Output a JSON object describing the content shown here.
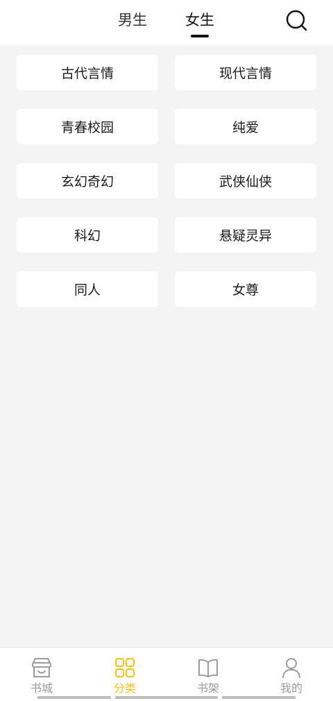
{
  "header": {
    "tabs": [
      {
        "label": "男生",
        "active": false
      },
      {
        "label": "女生",
        "active": true
      }
    ],
    "search_icon": "search-icon"
  },
  "categories": [
    "古代言情",
    "现代言情",
    "青春校园",
    "纯爱",
    "玄幻奇幻",
    "武侠仙侠",
    "科幻",
    "悬疑灵异",
    "同人",
    "女尊"
  ],
  "bottom_nav": {
    "items": [
      {
        "label": "书城",
        "icon": "store-icon",
        "active": false
      },
      {
        "label": "分类",
        "icon": "grid-icon",
        "active": true
      },
      {
        "label": "书架",
        "icon": "book-icon",
        "active": false
      },
      {
        "label": "我的",
        "icon": "user-icon",
        "active": false
      }
    ]
  },
  "colors": {
    "accent": "#f2c318",
    "inactive": "#9b9b9b",
    "background": "#f4f4f4"
  }
}
